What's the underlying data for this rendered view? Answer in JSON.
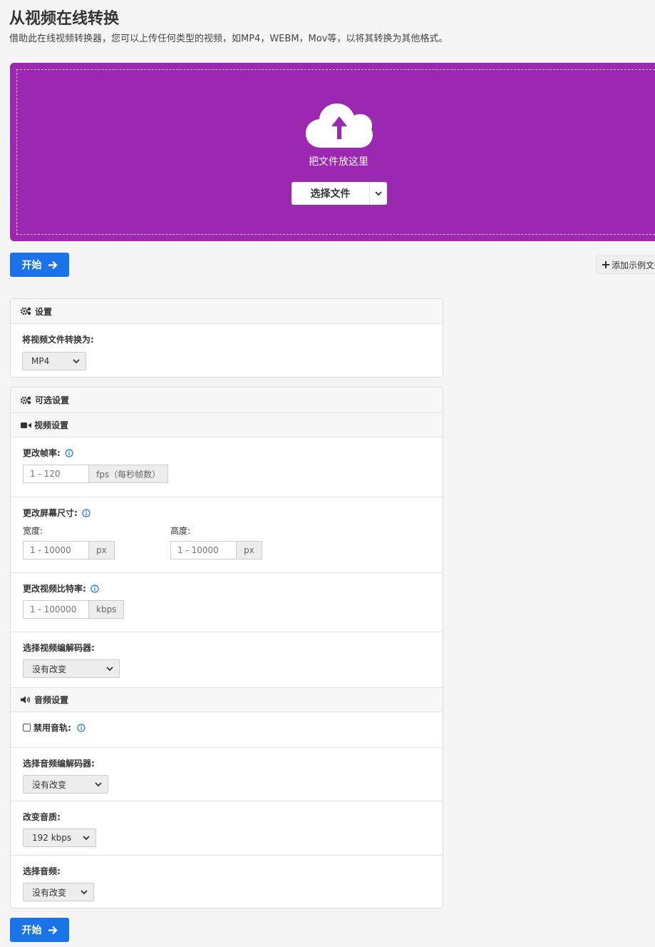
{
  "header": {
    "title": "从视频在线转换",
    "subtitle": "借助此在线视频转换器，您可以上传任何类型的视频，如MP4，WEBM，Mov等，以将其转换为其他格式。"
  },
  "dropzone": {
    "drop_text": "把文件放这里",
    "choose_label": "选择文件",
    "color": "#9c27b0"
  },
  "actions": {
    "start_label": "开始",
    "add_sample_label": "添加示例文件"
  },
  "settings": {
    "title": "设置",
    "convert_label": "将视频文件转换为:",
    "format_value": "MP4"
  },
  "optional": {
    "title": "可选设置",
    "video": {
      "title": "视频设置",
      "framerate_label": "更改帧率:",
      "framerate_placeholder": "1 - 120",
      "framerate_unit": "fps（每秒帧数）",
      "size_label": "更改屏幕尺寸:",
      "width_label": "宽度:",
      "width_placeholder": "1 - 10000",
      "height_label": "高度:",
      "height_placeholder": "1 - 10000",
      "px_unit": "px",
      "bitrate_label": "更改视频比特率:",
      "bitrate_placeholder": "1 - 100000",
      "bitrate_unit": "kbps",
      "codec_label": "选择视频编解码器:",
      "codec_value": "没有改变"
    },
    "audio": {
      "title": "音频设置",
      "disable_label": "禁用音轨:",
      "codec_label": "选择音频编解码器:",
      "codec_value": "没有改变",
      "quality_label": "改变音质:",
      "quality_value": "192 kbps",
      "channel_label": "选择音频:",
      "channel_value": "没有改变"
    }
  },
  "colors": {
    "primary": "#1a73e8",
    "info": "#1a73e8"
  }
}
